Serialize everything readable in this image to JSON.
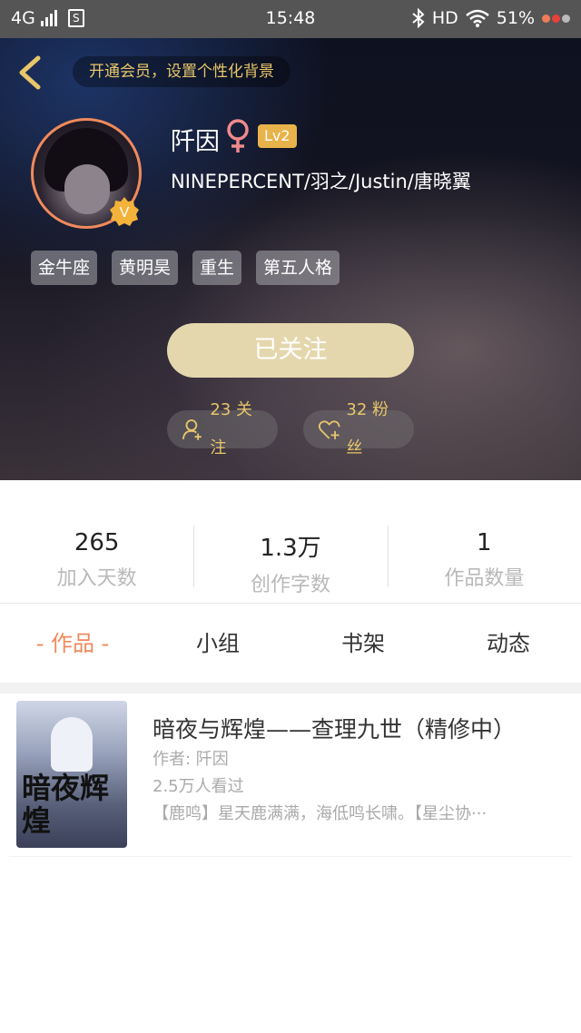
{
  "status_bar": {
    "network": "4G",
    "sim_label": "S",
    "time": "15:48",
    "hd": "HD",
    "battery": "51%"
  },
  "header": {
    "vip_banner": "开通会员，设置个性化背景",
    "username": "阡因",
    "level": "Lv2",
    "bio": "NINEPERCENT/羽之/Justin/唐晓翼",
    "badge_letter": "V",
    "tags": [
      "金牛座",
      "黄明昊",
      "重生",
      "第五人格"
    ],
    "follow_button": "已关注",
    "following": "23 关注",
    "fans": "32 粉丝"
  },
  "stats": [
    {
      "value": "265",
      "label": "加入天数"
    },
    {
      "value": "1.3万",
      "label": "创作字数"
    },
    {
      "value": "1",
      "label": "作品数量"
    }
  ],
  "tabs": [
    {
      "label": "- 作品 -",
      "active": true
    },
    {
      "label": "小组",
      "active": false
    },
    {
      "label": "书架",
      "active": false
    },
    {
      "label": "动态",
      "active": false
    }
  ],
  "books": [
    {
      "title": "暗夜与辉煌——查理九世（精修中）",
      "author": "作者: 阡因",
      "views": "2.5万人看过",
      "description": "【鹿鸣】星天鹿满满，海低鸣长啸。【星尘协···",
      "cover_text": "暗夜辉煌"
    }
  ],
  "colors": {
    "accent": "#f08a5d",
    "gold": "#e8c66a",
    "follow_button": "#e5d7ad",
    "level_badge": "#e8b34a"
  }
}
